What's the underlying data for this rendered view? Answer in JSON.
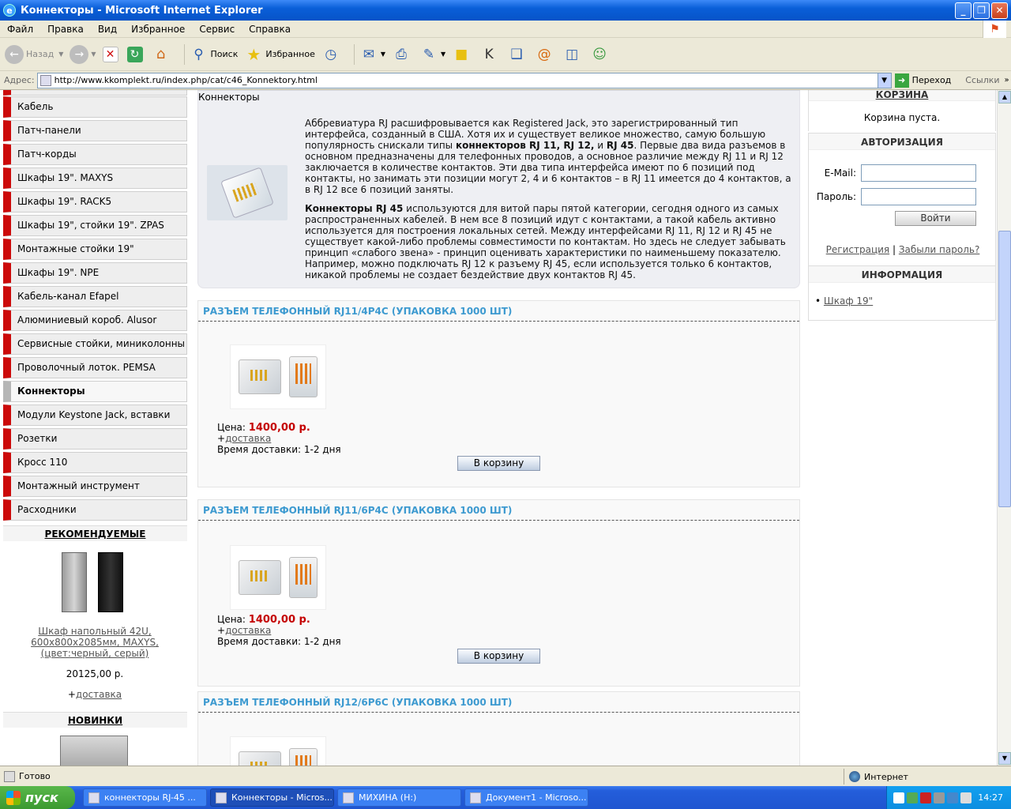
{
  "window": {
    "title": "Коннекторы - Microsoft Internet Explorer"
  },
  "menu": [
    "Файл",
    "Правка",
    "Вид",
    "Избранное",
    "Сервис",
    "Справка"
  ],
  "toolbar": {
    "back": "Назад",
    "search": "Поиск",
    "favorites": "Избранное"
  },
  "address": {
    "label": "Адрес:",
    "url": "http://www.kkomplekt.ru/index.php/cat/c46_Konnektory.html",
    "go": "Переход",
    "links": "Ссылки"
  },
  "categories": [
    "Кабель",
    "Патч-панели",
    "Патч-корды",
    "Шкафы 19\". MAXYS",
    "Шкафы 19\". RACK5",
    "Шкафы 19\", стойки 19\". ZPAS",
    "Монтажные стойки 19\"",
    "Шкафы 19\". NPE",
    "Кабель-канал Efapel",
    "Алюминиевый короб. Alusor",
    "Сервисные стойки, миниколонны",
    "Проволочный лоток. PEMSA",
    "Коннекторы",
    "Модули Keystone Jack, вставки",
    "Розетки",
    "Кросс 110",
    "Монтажный инструмент",
    "Расходники"
  ],
  "recommended": {
    "title": "РЕКОМЕНДУЕМЫЕ",
    "name": "Шкаф напольный 42U, 600x800x2085мм, MAXYS, (цвет:черный, серый)",
    "price": "20125,00 р.",
    "plus": "+",
    "delivery": "доставка"
  },
  "new": {
    "title": "НОВИНКИ"
  },
  "breadcrumb": "Коннекторы",
  "intro": {
    "p1a": "Аббревиатура RJ расшифровывается как Registered Jack, это зарегистрированный тип интерфейса, созданный в США. Хотя их и существует великое множество, самую большую популярность снискали типы ",
    "p1b": "коннекторов RJ 11, RJ 12,",
    "p1c": " и ",
    "p1d": "RJ 45",
    "p1e": ". Первые два вида разъемов в основном предназначены для телефонных проводов, а основное различие между RJ 11 и RJ 12 заключается в количестве контактов. Эти два типа интерфейса имеют по 6 позиций под контакты, но занимать эти позиции могут 2, 4 и 6 контактов – в RJ 11 имеется до 4 контактов, а в RJ 12 все 6 позиций заняты.",
    "p2a": "Коннекторы RJ 45",
    "p2b": " используются для витой пары пятой категории, сегодня одного из самых распространенных кабелей. В нем все 8 позиций идут с контактами, а такой кабель активно используется для построения локальных сетей. Между интерфейсами RJ 11, RJ 12 и RJ 45 не существует какой-либо проблемы совместимости по контактам. Но здесь не следует забывать принцип «слабого звена» - принцип оценивать характеристики по наименьшему показателю. Например, можно подключать RJ 12 к разъему RJ 45, если используется только 6 контактов, никакой проблемы не создает бездействие двух контактов RJ 45."
  },
  "products": [
    {
      "title": "РАЗЪЕМ ТЕЛЕФОННЫЙ RJ11/4P4C (УПАКОВКА 1000 ШТ)",
      "price_label": "Цена:",
      "price": "1400,00 р.",
      "plus": "+",
      "delivery": "доставка",
      "time": "Время доставки:  1-2 дня",
      "button": "В корзину"
    },
    {
      "title": "РАЗЪЕМ ТЕЛЕФОННЫЙ RJ11/6P4C (УПАКОВКА 1000 ШТ)",
      "price_label": "Цена:",
      "price": "1400,00 р.",
      "plus": "+",
      "delivery": "доставка",
      "time": "Время доставки:  1-2 дня",
      "button": "В корзину"
    },
    {
      "title": "РАЗЪЕМ ТЕЛЕФОННЫЙ RJ12/6P6C (УПАКОВКА 1000 ШТ)"
    }
  ],
  "cart": {
    "title": "КОРЗИНА",
    "empty": "Корзина пуста."
  },
  "auth": {
    "title": "АВТОРИЗАЦИЯ",
    "email_label": "E-Mail:",
    "password_label": "Пароль:",
    "login": "Войти",
    "register": "Регистрация",
    "sep": "|",
    "forgot": "Забыли пароль?"
  },
  "info": {
    "title": "ИНФОРМАЦИЯ",
    "item": "Шкаф 19\""
  },
  "status": {
    "text": "Готово",
    "zone": "Интернет"
  },
  "taskbar": {
    "start": "пуск",
    "tasks": [
      "коннекторы RJ-45 ...",
      "Коннекторы - Micros...",
      "МИХИНА (H:)",
      "Документ1 - Microso..."
    ],
    "clock": "14:27"
  }
}
